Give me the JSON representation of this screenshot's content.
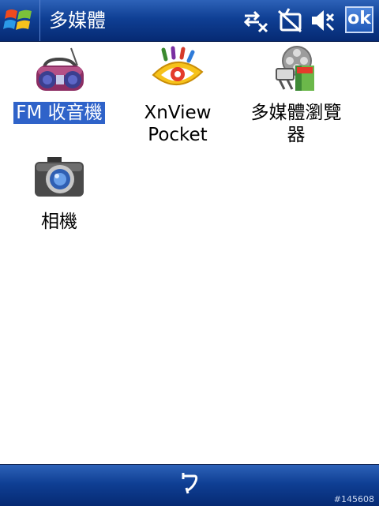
{
  "titlebar": {
    "title": "多媒體",
    "ok_label": "ok",
    "icons": [
      "windows-start-icon",
      "connectivity-icon",
      "phone-off-icon",
      "volume-mute-icon"
    ]
  },
  "apps": [
    {
      "label": "FM 收音機",
      "icon": "radio-icon",
      "selected": true
    },
    {
      "label": "XnView Pocket",
      "label_lines": [
        "XnView",
        "Pocket"
      ],
      "icon": "xnview-eye-icon"
    },
    {
      "label": "多媒體瀏覽器",
      "label_lines": [
        "多媒體瀏覽",
        "器"
      ],
      "icon": "media-browser-icon"
    },
    {
      "label": "相機",
      "icon": "camera-icon"
    }
  ],
  "bottombar": {
    "back_icon": "back-arrow-icon",
    "watermark": "#145608"
  },
  "colors": {
    "bar_top": "#2d62b8",
    "bar_bottom": "#062a73",
    "selection": "#2f63c9"
  }
}
